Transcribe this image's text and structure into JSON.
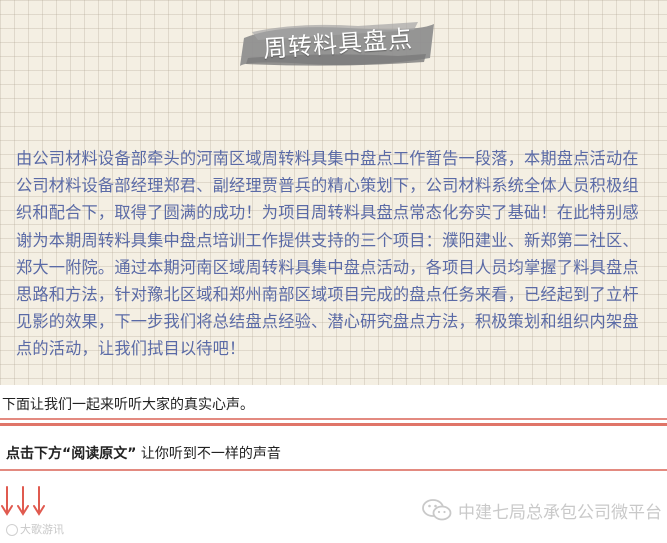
{
  "title": "周转料具盘点",
  "paragraph": "由公司材料设备部牵头的河南区域周转料具集中盘点工作暂告一段落，本期盘点活动在公司材料设备部经理郑君、副经理贾普兵的精心策划下，公司材料系统全体人员积极组织和配合下，取得了圆满的成功！为项目周转料具盘点常态化夯实了基础！在此特别感谢为本期周转料具集中盘点培训工作提供支持的三个项目：濮阳建业、新郑第二社区、郑大一附院。通过本期河南区域周转料具集中盘点活动，各项目人员均掌握了料具盘点思路和方法，针对豫北区域和郑州南部区域项目完成的盘点任务来看，已经起到了立杆见影的效果，下一步我们将总结盘点经验、潜心研究盘点方法，积极策划和组织内架盘点的活动，让我们拭目以待吧！",
  "intro_line": "下面让我们一起来听听大家的真实心声。",
  "cta": {
    "part1": "点击下方",
    "part2": "“阅读原文”",
    "part3": " 让你听到不一样的声音"
  },
  "brand_left": "大歌游讯",
  "watermark": "中建七局总承包公司微平台",
  "colors": {
    "paragraph": "#5a6aa6",
    "rule": "#e07568",
    "arrows": "#e05a4f",
    "badge": "#8f8f8f"
  },
  "icons": [
    "down-arrow-icon",
    "wechat-icon",
    "logo-icon"
  ]
}
